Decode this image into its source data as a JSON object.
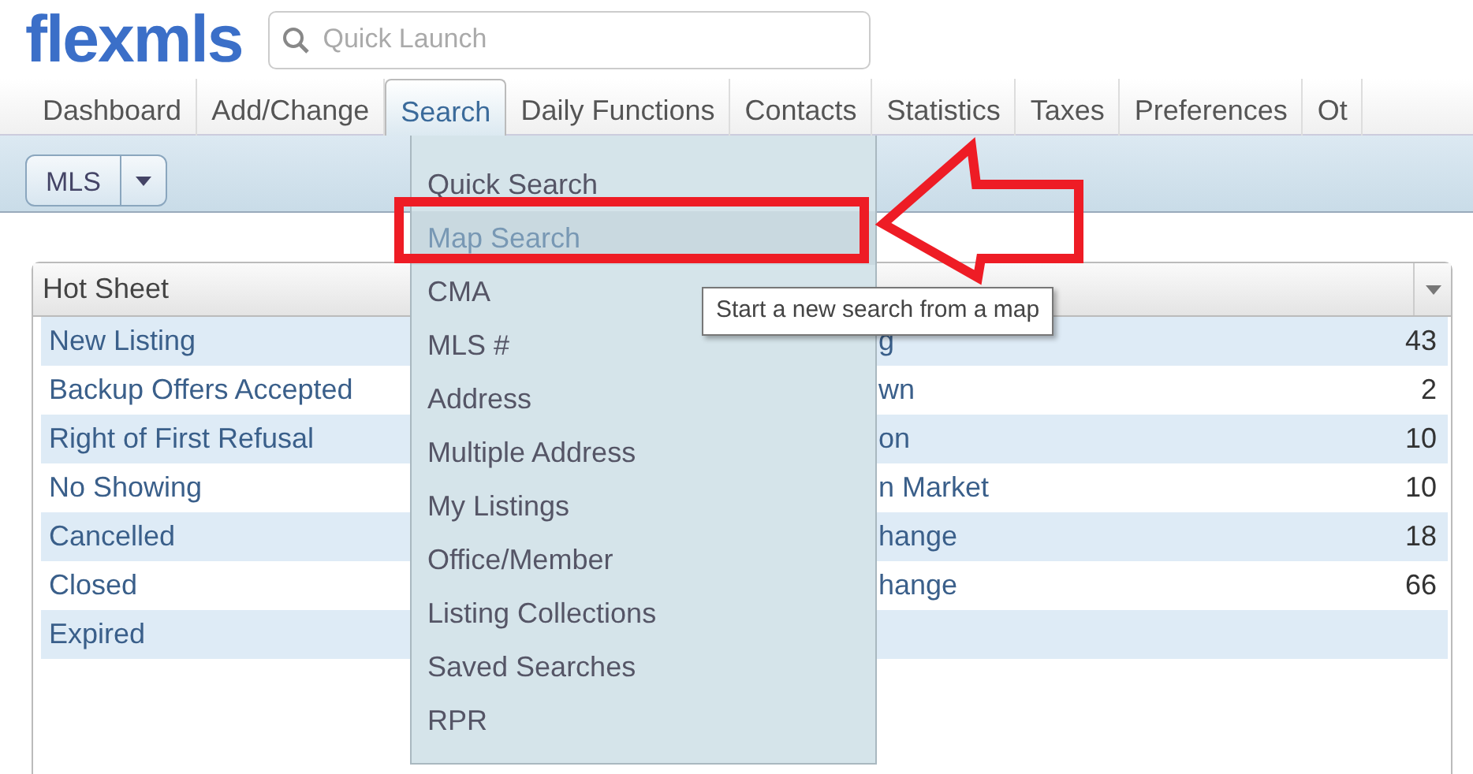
{
  "logo": "flexmls",
  "quick_launch": {
    "placeholder": "Quick Launch"
  },
  "tabs": [
    {
      "label": "Dashboard",
      "selected": false
    },
    {
      "label": "Add/Change",
      "selected": false
    },
    {
      "label": "Search",
      "selected": true
    },
    {
      "label": "Daily Functions",
      "selected": false
    },
    {
      "label": "Contacts",
      "selected": false
    },
    {
      "label": "Statistics",
      "selected": false
    },
    {
      "label": "Taxes",
      "selected": false
    },
    {
      "label": "Preferences",
      "selected": false
    },
    {
      "label": "Ot",
      "selected": false
    }
  ],
  "toolbar": {
    "mls_button": "MLS"
  },
  "search_menu": [
    {
      "label": "Quick Search",
      "selected": false
    },
    {
      "label": "Map Search",
      "selected": true
    },
    {
      "label": "CMA",
      "selected": false
    },
    {
      "label": "MLS #",
      "selected": false
    },
    {
      "label": "Address",
      "selected": false
    },
    {
      "label": "Multiple Address",
      "selected": false
    },
    {
      "label": "My Listings",
      "selected": false
    },
    {
      "label": "Office/Member",
      "selected": false
    },
    {
      "label": "Listing Collections",
      "selected": false
    },
    {
      "label": "Saved Searches",
      "selected": false
    },
    {
      "label": "RPR",
      "selected": false
    }
  ],
  "tooltip": "Start a new search from a map",
  "hot_sheet": {
    "title": "Hot Sheet",
    "left_items": [
      "New Listing",
      "Backup Offers Accepted",
      "Right of First Refusal",
      "No Showing",
      "Cancelled",
      "Closed",
      "Expired"
    ],
    "right_items": [
      {
        "label": "g",
        "count": "43"
      },
      {
        "label": "wn",
        "count": "2"
      },
      {
        "label": "on",
        "count": "10"
      },
      {
        "label": "n Market",
        "count": "10"
      },
      {
        "label": "hange",
        "count": "18"
      },
      {
        "label": "hange",
        "count": "66"
      }
    ]
  }
}
